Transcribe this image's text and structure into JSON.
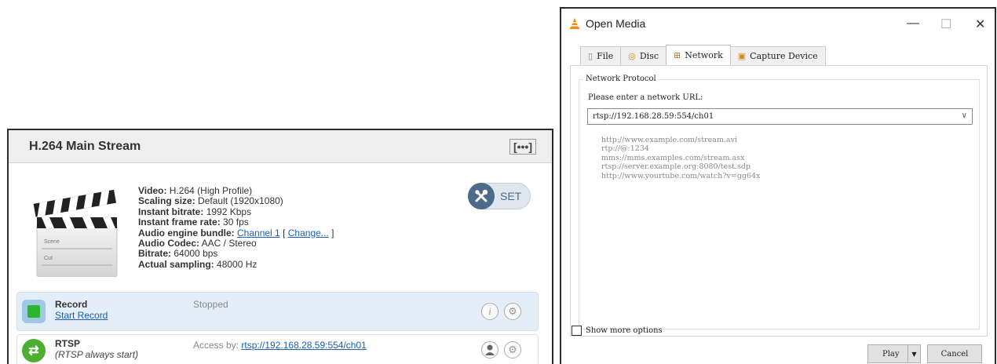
{
  "stream_panel": {
    "title": "H.264 Main Stream",
    "menu_label": "[•••]",
    "clapper": {
      "scene": "Scene",
      "cut": "Cut"
    },
    "properties": {
      "video_label": "Video:",
      "video_value": "H.264 (High Profile)",
      "scaling_label": "Scaling size:",
      "scaling_value": "Default (1920x1080)",
      "bitrate_label": "Instant bitrate:",
      "bitrate_value": "1992 Kbps",
      "framerate_label": "Instant frame rate:",
      "framerate_value": "30 fps",
      "audio_bundle_label": "Audio engine bundle:",
      "audio_bundle_link": "Channel 1",
      "change_open": "[",
      "change_link": "Change...",
      "change_close": "]",
      "audio_codec_label": "Audio Codec:",
      "audio_codec_value": "AAC / Stereo",
      "audio_bitrate_label": "Bitrate:",
      "audio_bitrate_value": "64000 bps",
      "sampling_label": "Actual sampling:",
      "sampling_value": "48000 Hz"
    },
    "set_label": "SET",
    "record": {
      "name": "Record",
      "action": "Start Record",
      "status": "Stopped"
    },
    "rtsp": {
      "name": "RTSP",
      "note": "(RTSP always start)",
      "access_label": "Access by:",
      "access_url": "rtsp://192.168.28.59:554/ch01"
    }
  },
  "dialog": {
    "title": "Open Media",
    "window_buttons": {
      "minimize": "—",
      "maximize": "☐",
      "close": "✕"
    },
    "tabs": [
      {
        "label": "File",
        "icon": "file-icon"
      },
      {
        "label": "Disc",
        "icon": "disc-icon"
      },
      {
        "label": "Network",
        "icon": "network-icon"
      },
      {
        "label": "Capture Device",
        "icon": "capture-device-icon"
      }
    ],
    "active_tab": "Network",
    "group_label": "Network Protocol",
    "url_label": "Please enter a network URL:",
    "url_value": "rtsp://192.168.28.59:554/ch01",
    "examples": [
      "http://www.example.com/stream.avi",
      "rtp://@:1234",
      "mms://mms.examples.com/stream.asx",
      "rtsp://server.example.org:8080/test.sdp",
      "http://www.yourtube.com/watch?v=gg64x"
    ],
    "show_more_label": "Show more options",
    "play_label": "Play",
    "cancel_label": "Cancel"
  },
  "colors": {
    "vlc_orange": "#f28c00",
    "record_green": "#2db52d",
    "rtsp_green": "#4caf32",
    "set_blue": "#4d6a8a",
    "link_blue": "#1a5fb4"
  }
}
